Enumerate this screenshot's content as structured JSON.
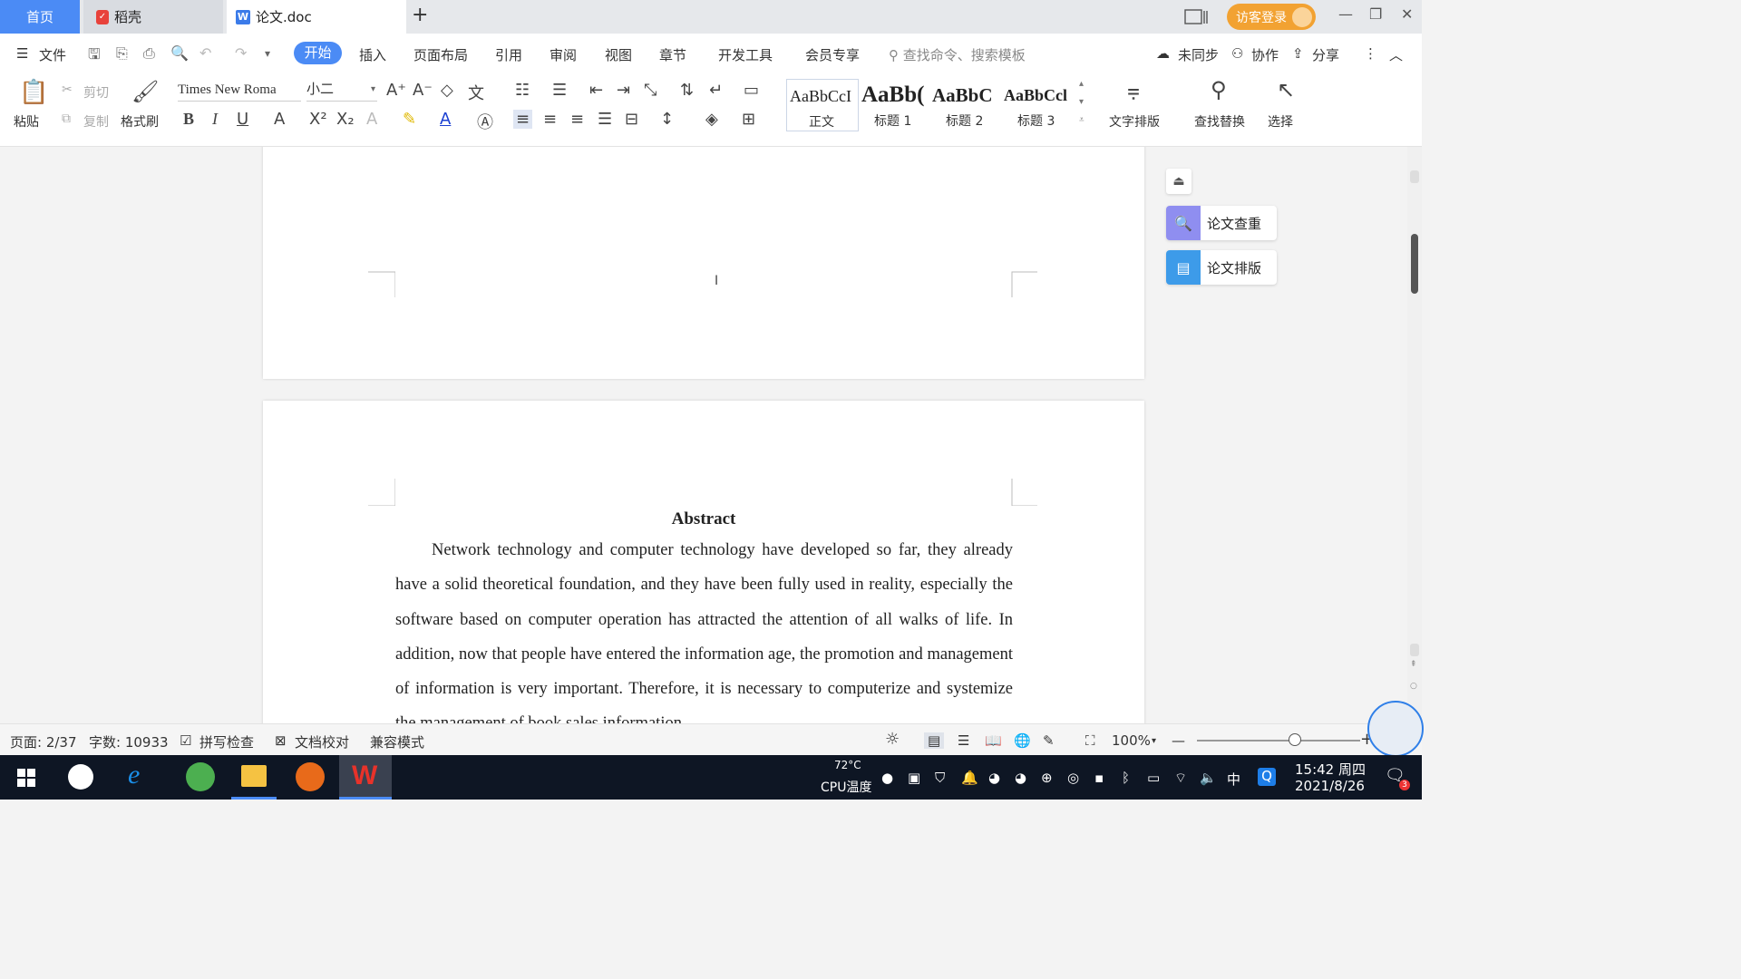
{
  "tabs": {
    "home": "首页",
    "daoke": "稻壳",
    "doc": "论文.doc",
    "new_tab": "+"
  },
  "header": {
    "visitor_login": "访客登录"
  },
  "menu": {
    "file": "文件",
    "items": [
      "开始",
      "插入",
      "页面布局",
      "引用",
      "审阅",
      "视图",
      "章节",
      "开发工具",
      "会员专享"
    ],
    "search_placeholder": "查找命令、搜索模板",
    "unsync": "未同步",
    "collab": "协作",
    "share": "分享"
  },
  "ribbon": {
    "paste": "粘贴",
    "cut": "剪切",
    "copy": "复制",
    "format_painter": "格式刷",
    "font_name": "Times New Roma",
    "font_size": "小二",
    "styles": [
      {
        "preview": "AaBbCcI",
        "label": "正文"
      },
      {
        "preview": "AaBb(",
        "label": "标题 1"
      },
      {
        "preview": "AaBbC",
        "label": "标题 2"
      },
      {
        "preview": "AaBbCcl",
        "label": "标题 3"
      }
    ],
    "text_layout": "文字排版",
    "find_replace": "查找替换",
    "select": "选择"
  },
  "side_panel": {
    "check": "论文查重",
    "layout": "论文排版"
  },
  "document": {
    "abstract_title": "Abstract",
    "abstract_body": "Network technology and computer technology have developed so far, they already have a solid theoretical foundation, and they have been fully used in reality, especially the software based on computer operation has attracted the attention of all walks of life. In addition, now that people have entered the information age, the promotion and management of information is very important. Therefore, it is necessary to computerize and systemize the management of book sales information"
  },
  "status": {
    "page": "页面: 2/37",
    "word_count": "字数: 10933",
    "spell_check": "拼写检查",
    "doc_proof": "文档校对",
    "compat_mode": "兼容模式",
    "zoom": "100%",
    "zoom_level_fraction": 0.6
  },
  "taskbar": {
    "cpu_temp": "72°C",
    "cpu_label": "CPU温度",
    "ime": "中",
    "time": "15:42 周四",
    "date": "2021/8/26",
    "notif_count": "3"
  }
}
